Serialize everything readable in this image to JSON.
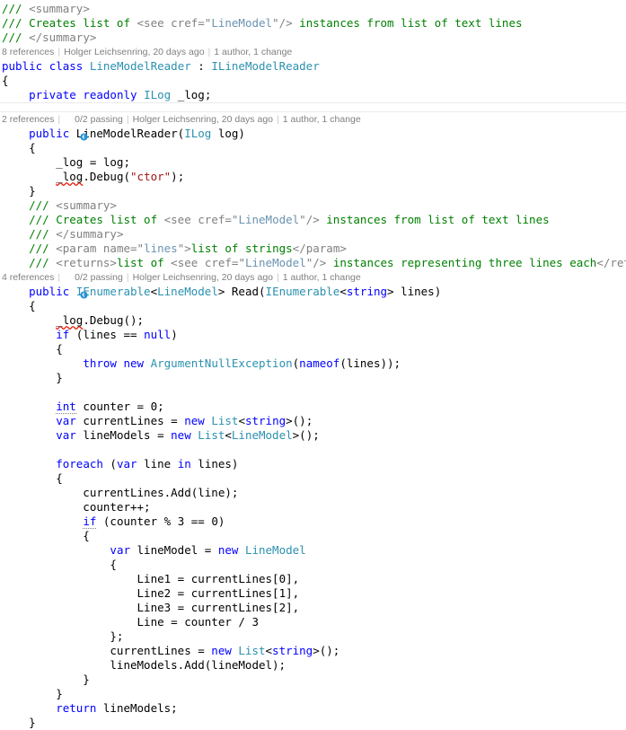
{
  "editor": {
    "language": "csharp",
    "theme": "visual-studio-light",
    "background_color": "#ffffff",
    "colors": {
      "keyword": "#0000ff",
      "type": "#2b91af",
      "string": "#a31515",
      "comment": "#008000",
      "xml_doc_tag": "#808080",
      "xml_doc_value": "#6a93b0",
      "plain": "#000000",
      "codelens_text": "#808080",
      "codelens_separator": "#c8c8c8",
      "test_icon": "#1e90d2",
      "region_rule": "#eaeaea",
      "error_squiggle": "#e51400"
    }
  },
  "codelens": [
    {
      "id": "class-linemodelreader",
      "references": "8 references",
      "has_test_status": false,
      "test_status": "",
      "author_change": "Holger Leichsenring, 20 days ago",
      "history": "1 author, 1 change"
    },
    {
      "id": "ctor-linemodelreader",
      "references": "2 references",
      "has_test_status": true,
      "test_status": "0/2 passing",
      "author_change": "Holger Leichsenring, 20 days ago",
      "history": "1 author, 1 change"
    },
    {
      "id": "method-read",
      "references": "4 references",
      "has_test_status": true,
      "test_status": "0/2 passing",
      "author_change": "Holger Leichsenring, 20 days ago",
      "history": "1 author, 1 change"
    }
  ],
  "code": {
    "line_01": "/// <summary>",
    "line_02": "/// Creates list of <see cref=\"LineModel\"/> instances from list of text lines",
    "line_03": "/// </summary>",
    "line_04": "public class LineModelReader : ILineModelReader",
    "line_05": "{",
    "line_06": "    private readonly ILog _log;",
    "line_07": "    public LineModelReader(ILog log)",
    "line_08": "    {",
    "line_09": "        _log = log;",
    "line_10": "        _log.Debug(\"ctor\");",
    "line_11": "    }",
    "line_12": "    /// <summary>",
    "line_13": "    /// Creates list of <see cref=\"LineModel\"/> instances from list of text lines",
    "line_14": "    /// </summary>",
    "line_15": "    /// <param name=\"lines\">list of strings</param>",
    "line_16": "    /// <returns>list of <see cref=\"LineModel\"/> instances representing three lines each</returns>",
    "line_17": "    public IEnumerable<LineModel> Read(IEnumerable<string> lines)",
    "line_18": "    {",
    "line_19": "        _log.Debug();",
    "line_20": "        if (lines == null)",
    "line_21": "        {",
    "line_22": "            throw new ArgumentNullException(nameof(lines));",
    "line_23": "        }",
    "line_24": "",
    "line_25": "        int counter = 0;",
    "line_26": "        var currentLines = new List<string>();",
    "line_27": "        var lineModels = new List<LineModel>();",
    "line_28": "",
    "line_29": "        foreach (var line in lines)",
    "line_30": "        {",
    "line_31": "            currentLines.Add(line);",
    "line_32": "            counter++;",
    "line_33": "            if (counter % 3 == 0)",
    "line_34": "            {",
    "line_35": "                var lineModel = new LineModel",
    "line_36": "                {",
    "line_37": "                    Line1 = currentLines[0],",
    "line_38": "                    Line2 = currentLines[1],",
    "line_39": "                    Line3 = currentLines[2],",
    "line_40": "                    Line = counter / 3",
    "line_41": "                };",
    "line_42": "                currentLines = new List<string>();",
    "line_43": "                lineModels.Add(lineModel);",
    "line_44": "            }",
    "line_45": "        }",
    "line_46": "        return lineModels;",
    "line_47": "    }"
  },
  "icons": {
    "test_not_run": "test-status-icon"
  }
}
